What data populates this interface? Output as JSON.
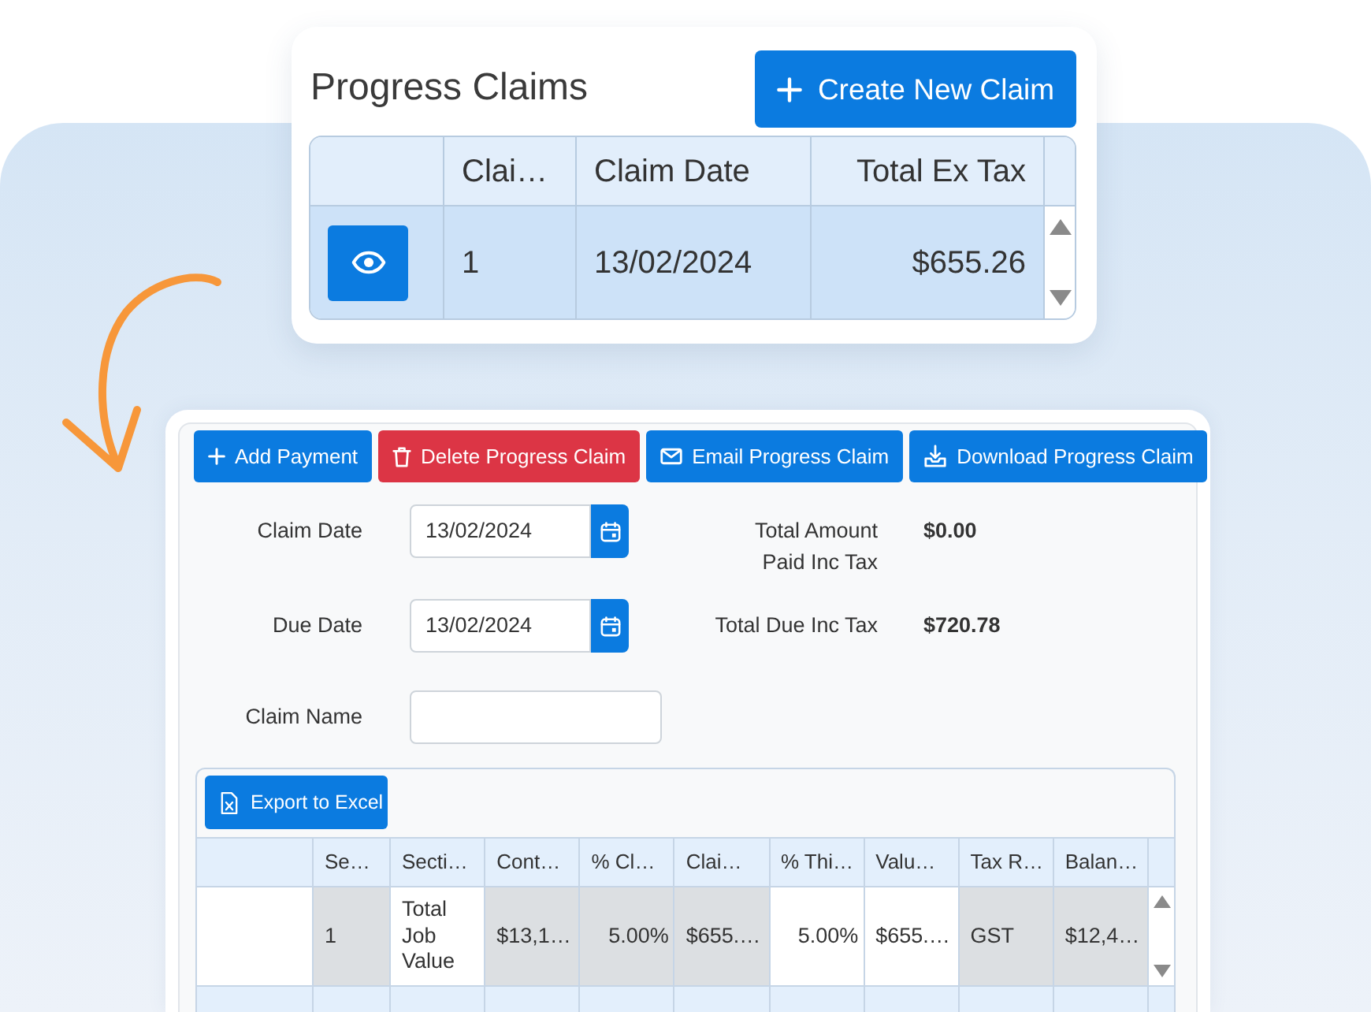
{
  "top_panel": {
    "title": "Progress Claims",
    "create_button": {
      "label": "Create New Claim"
    },
    "table": {
      "columns": [
        {
          "label": "Clai…",
          "kind": "text"
        },
        {
          "label": "Claim Date",
          "kind": "text"
        },
        {
          "label": "Total Ex Tax",
          "kind": "numeric"
        }
      ],
      "rows": [
        {
          "selected": true,
          "cells": [
            "1",
            "13/02/2024",
            "$655.26"
          ]
        }
      ]
    }
  },
  "claim_panel": {
    "buttons": [
      {
        "label": "Add Payment",
        "kind": "add"
      },
      {
        "label": "Delete Progress Claim",
        "kind": "delete"
      },
      {
        "label": "Email Progress Claim",
        "kind": "email"
      },
      {
        "label": "Download Progress Claim",
        "kind": "download"
      }
    ],
    "fields": [
      {
        "label": "Claim Date",
        "kind": "date",
        "value": "13/02/2024"
      },
      {
        "label": "Due Date",
        "kind": "date",
        "value": "13/02/2024"
      },
      {
        "label": "Claim Name",
        "kind": "text"
      }
    ],
    "totals": [
      {
        "label": "Total Amount Paid Inc Tax",
        "value": "$0.00"
      },
      {
        "label": "Total Due Inc Tax",
        "value": "$720.78"
      }
    ],
    "grid": {
      "export_button": {
        "label": "Export to Excel"
      },
      "columns": [
        {
          "label": "Se…",
          "kind": "text",
          "readonly": true
        },
        {
          "label": "Secti…",
          "kind": "text",
          "readonly": false
        },
        {
          "label": "Cont…",
          "kind": "text",
          "readonly": true
        },
        {
          "label": "% Cl…",
          "kind": "numeric",
          "readonly": true
        },
        {
          "label": "Clai…",
          "kind": "text",
          "readonly": true
        },
        {
          "label": "% Thi…",
          "kind": "numeric",
          "readonly": false
        },
        {
          "label": "Valu…",
          "kind": "text",
          "readonly": false
        },
        {
          "label": "Tax R…",
          "kind": "text",
          "readonly": true
        },
        {
          "label": "Balan…",
          "kind": "text",
          "readonly": true
        }
      ],
      "rows": [
        {
          "cells": [
            "1",
            "Total Job Value",
            "$13,1…",
            "5.00%",
            "$655.…",
            "5.00%",
            "$655.…",
            "GST",
            "$12,4…"
          ]
        }
      ]
    }
  }
}
